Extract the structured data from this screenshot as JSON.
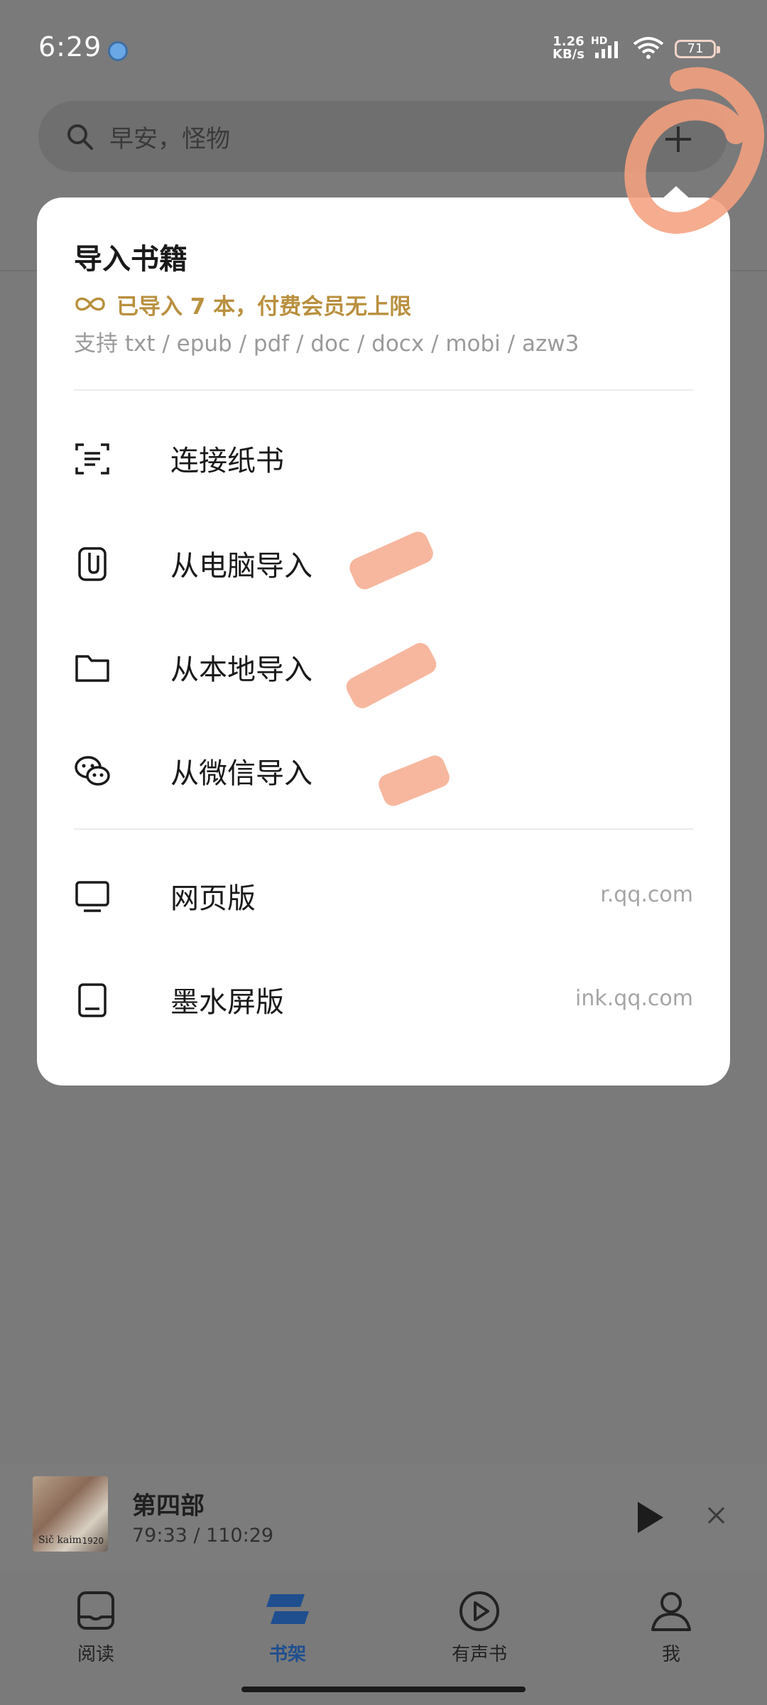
{
  "status_bar": {
    "time": "6:29",
    "net_speed_value": "1.26",
    "net_speed_unit": "KB/s",
    "network_type": "HD",
    "battery": "71"
  },
  "search": {
    "placeholder": "早安，怪物"
  },
  "import_panel": {
    "title": "导入书籍",
    "quota": "已导入 7 本，付费会员无上限",
    "formats": "支持 txt / epub / pdf / doc / docx / mobi / azw3",
    "items": [
      {
        "label": "连接纸书",
        "icon": "scan-icon"
      },
      {
        "label": "从电脑导入",
        "icon": "phone-clip-icon"
      },
      {
        "label": "从本地导入",
        "icon": "folder-icon"
      },
      {
        "label": "从微信导入",
        "icon": "wechat-icon"
      }
    ],
    "links": [
      {
        "label": "网页版",
        "url": "r.qq.com",
        "icon": "monitor-icon"
      },
      {
        "label": "墨水屏版",
        "url": "ink.qq.com",
        "icon": "tablet-icon"
      }
    ]
  },
  "now_playing": {
    "title": "第四部",
    "progress": "79:33 / 110:29",
    "cover_text": "Sič kaim",
    "cover_year": "1920"
  },
  "bottom_nav": {
    "tabs": [
      {
        "label": "阅读",
        "icon": "reading-icon",
        "active": false
      },
      {
        "label": "书架",
        "icon": "bookshelf-icon",
        "active": true
      },
      {
        "label": "有声书",
        "icon": "audiobook-icon",
        "active": false
      },
      {
        "label": "我",
        "icon": "profile-icon",
        "active": false
      }
    ]
  },
  "colors": {
    "accent_gold": "#b9903f",
    "active_blue": "#1f4f8f",
    "redaction": "#f7b39a"
  }
}
